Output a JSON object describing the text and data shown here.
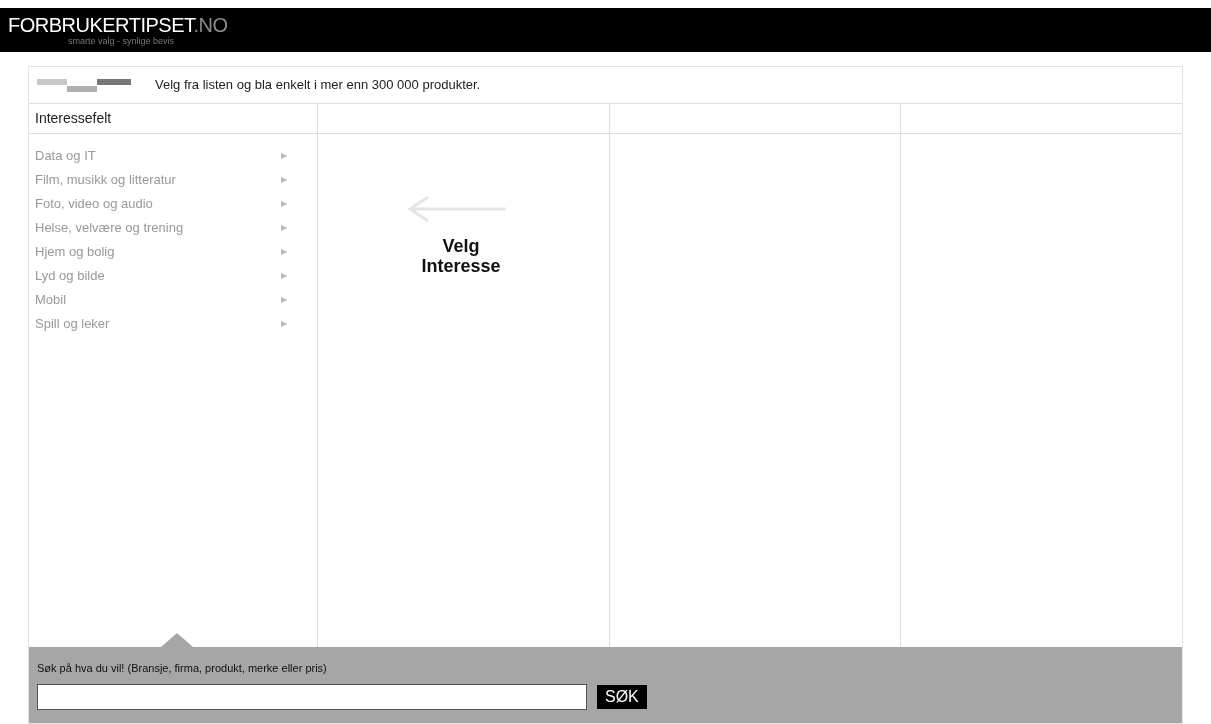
{
  "header": {
    "logo_main": "FORBRUKERTIPSET",
    "logo_suffix": ".NO",
    "tagline": "smarte valg - synlige bevis"
  },
  "intro": "Velg fra listen og bla enkelt i mer enn 300 000 produkter.",
  "sidebar": {
    "title": "Interessefelt",
    "items": [
      {
        "label": "Data og IT",
        "arrow": "▶"
      },
      {
        "label": "Film, musikk og litteratur",
        "arrow": "▶"
      },
      {
        "label": "Foto, video og audio",
        "arrow": "▶"
      },
      {
        "label": "Helse, velvære og trening",
        "arrow": "▶"
      },
      {
        "label": "Hjem og bolig",
        "arrow": "▶"
      },
      {
        "label": "Lyd og bilde",
        "arrow": "▶"
      },
      {
        "label": "Mobil",
        "arrow": "▶"
      },
      {
        "label": "Spill og leker",
        "arrow": "▶"
      }
    ]
  },
  "prompt": "Velg Interesse",
  "search": {
    "label": "Søk på hva du vil! (Bransje, firma, produkt, merke eller pris)",
    "button": "SØK"
  }
}
